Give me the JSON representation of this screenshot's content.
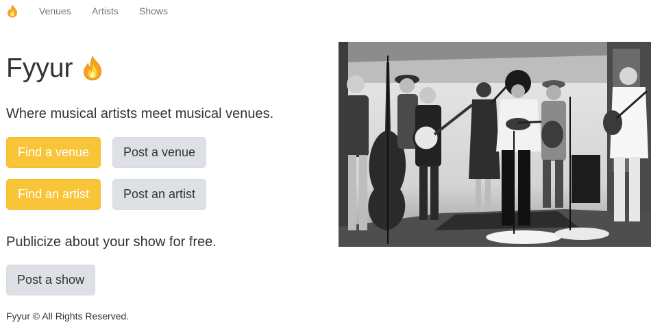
{
  "nav": {
    "logo_icon": "flame-icon",
    "links": [
      "Venues",
      "Artists",
      "Shows"
    ]
  },
  "hero": {
    "title": "Fyyur",
    "title_icon": "flame-icon",
    "tagline": "Where musical artists meet musical venues.",
    "buttons": {
      "find_venue": "Find a venue",
      "post_venue": "Post a venue",
      "find_artist": "Find an artist",
      "post_artist": "Post an artist"
    },
    "publicize": "Publicize about your show for free.",
    "post_show": "Post a show"
  },
  "photo": {
    "subject": "black-and-white photo of a band performing with instruments"
  },
  "footer": {
    "text": "Fyyur © All Rights Reserved."
  },
  "colors": {
    "primary": "#f8c438",
    "default_button": "#dde1e6",
    "nav_link": "#777777",
    "text": "#333333",
    "flame_outer": "#f5a623",
    "flame_inner": "#ffd93b"
  }
}
